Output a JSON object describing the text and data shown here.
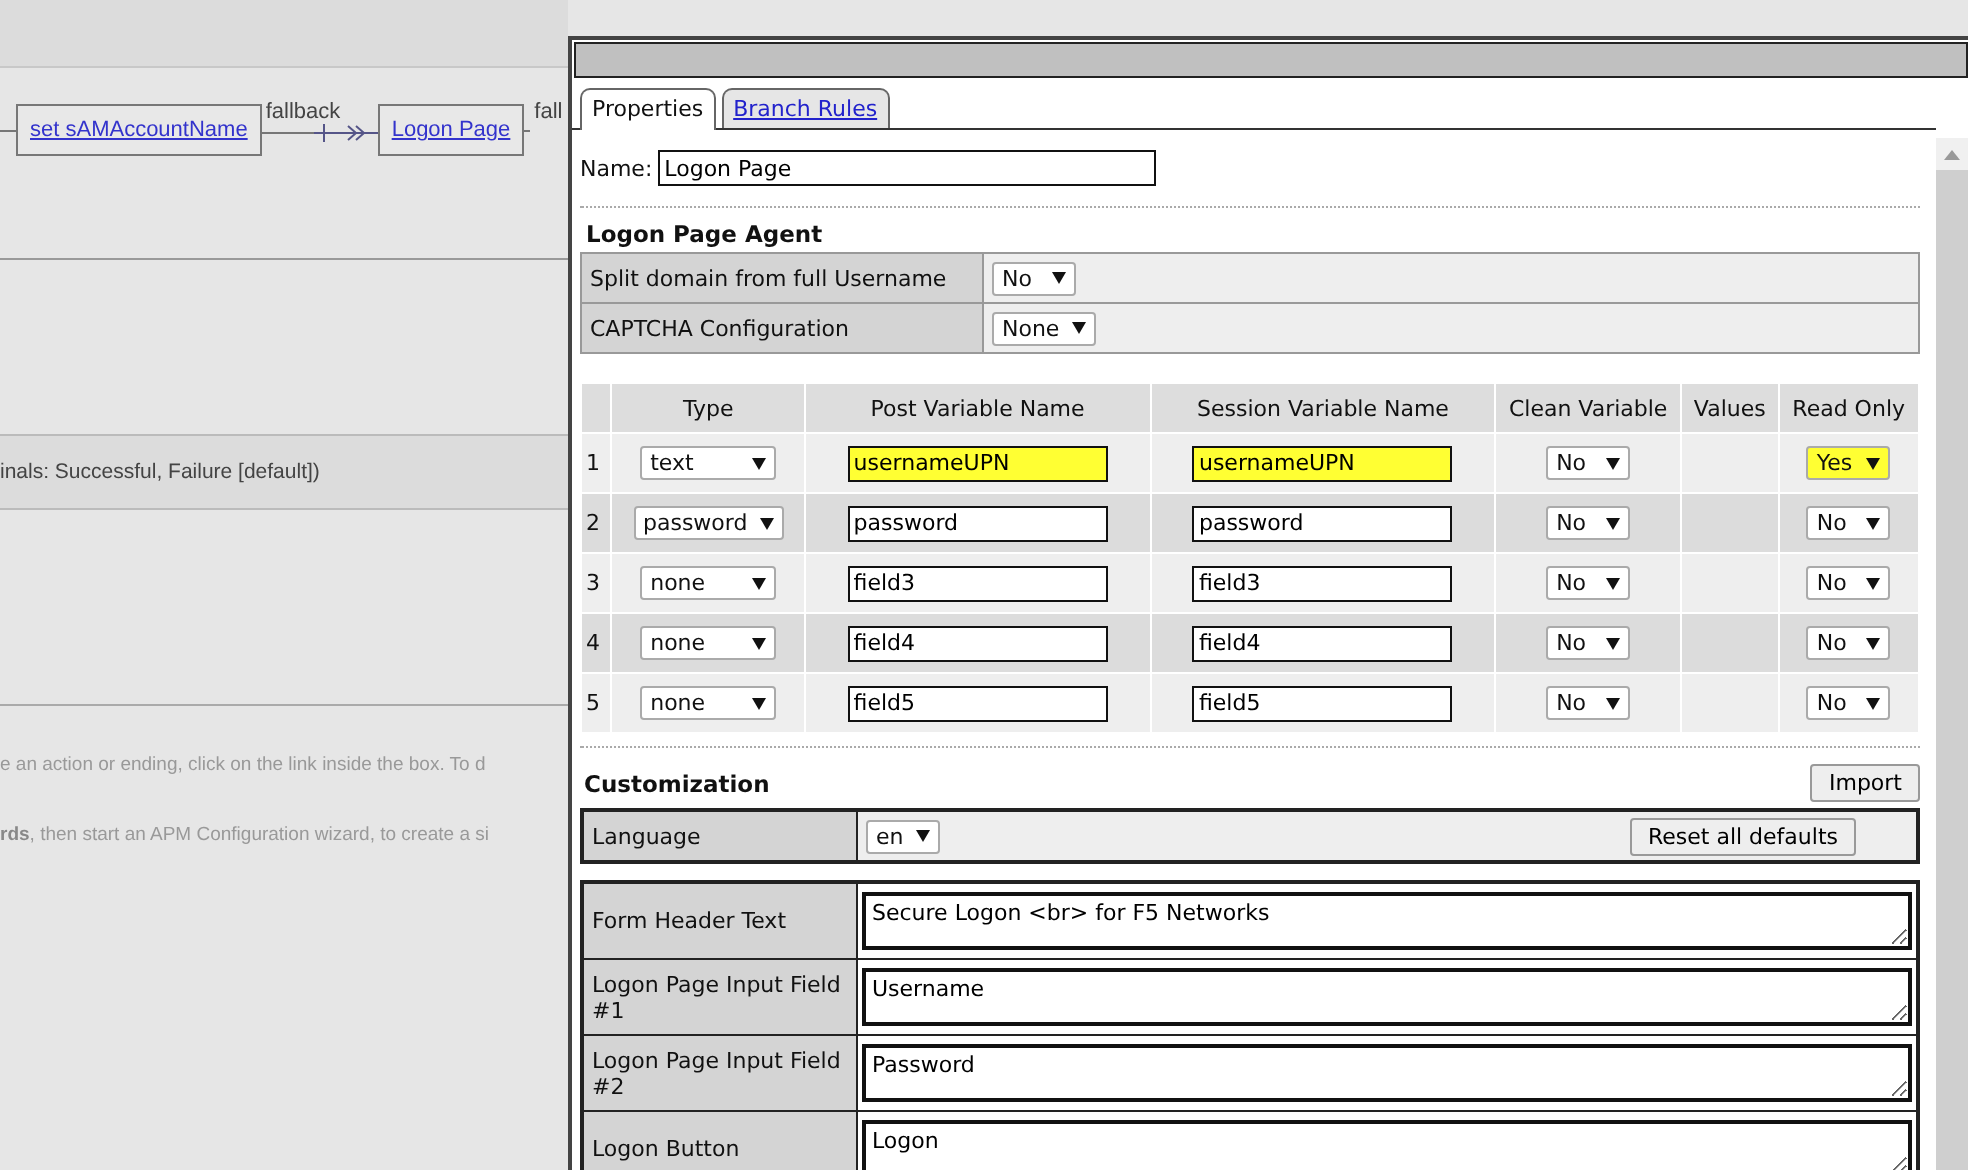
{
  "background": {
    "flow_nodes": [
      {
        "label": "set sAMAccountName"
      },
      {
        "label": "Logon Page"
      }
    ],
    "connector_label": "fallback",
    "trailing_label": "fall",
    "terminals_text": "inals: Successful, Failure [default])",
    "help_lines": [
      "e an action or ending, click on the link inside the box. To d",
      "**rds**, then start an APM Configuration wizard, to create a si"
    ]
  },
  "dialog": {
    "tabs": [
      {
        "label": "Properties",
        "selected": true
      },
      {
        "label": "Branch Rules",
        "selected": false
      }
    ],
    "name": {
      "label": "Name:",
      "value": "Logon Page"
    },
    "agent": {
      "title": "Logon Page Agent",
      "settings": [
        {
          "label": "Split domain from full Username",
          "value": "No"
        },
        {
          "label": "CAPTCHA Configuration",
          "value": "None"
        }
      ]
    },
    "fields_table": {
      "columns": [
        "Type",
        "Post Variable Name",
        "Session Variable Name",
        "Clean Variable",
        "Values",
        "Read Only"
      ],
      "rows": [
        {
          "index": "1",
          "type": "text",
          "post_variable": "usernameUPN",
          "session_variable": "usernameUPN",
          "clean_variable": "No",
          "read_only": "Yes",
          "highlighted": true
        },
        {
          "index": "2",
          "type": "password",
          "post_variable": "password",
          "session_variable": "password",
          "clean_variable": "No",
          "read_only": "No",
          "highlighted": false
        },
        {
          "index": "3",
          "type": "none",
          "post_variable": "field3",
          "session_variable": "field3",
          "clean_variable": "No",
          "read_only": "No",
          "highlighted": false
        },
        {
          "index": "4",
          "type": "none",
          "post_variable": "field4",
          "session_variable": "field4",
          "clean_variable": "No",
          "read_only": "No",
          "highlighted": false
        },
        {
          "index": "5",
          "type": "none",
          "post_variable": "field5",
          "session_variable": "field5",
          "clean_variable": "No",
          "read_only": "No",
          "highlighted": false
        }
      ]
    },
    "customization": {
      "title": "Customization",
      "import_button": "Import",
      "language": {
        "label": "Language",
        "value": "en"
      },
      "reset_button": "Reset all defaults",
      "texts": [
        {
          "label": "Form Header Text",
          "value": "Secure Logon <br> for F5 Networks"
        },
        {
          "label": "Logon Page Input Field #1",
          "value": "Username"
        },
        {
          "label": "Logon Page Input Field #2",
          "value": "Password"
        },
        {
          "label": "Logon Button",
          "value": "Logon"
        }
      ]
    }
  }
}
